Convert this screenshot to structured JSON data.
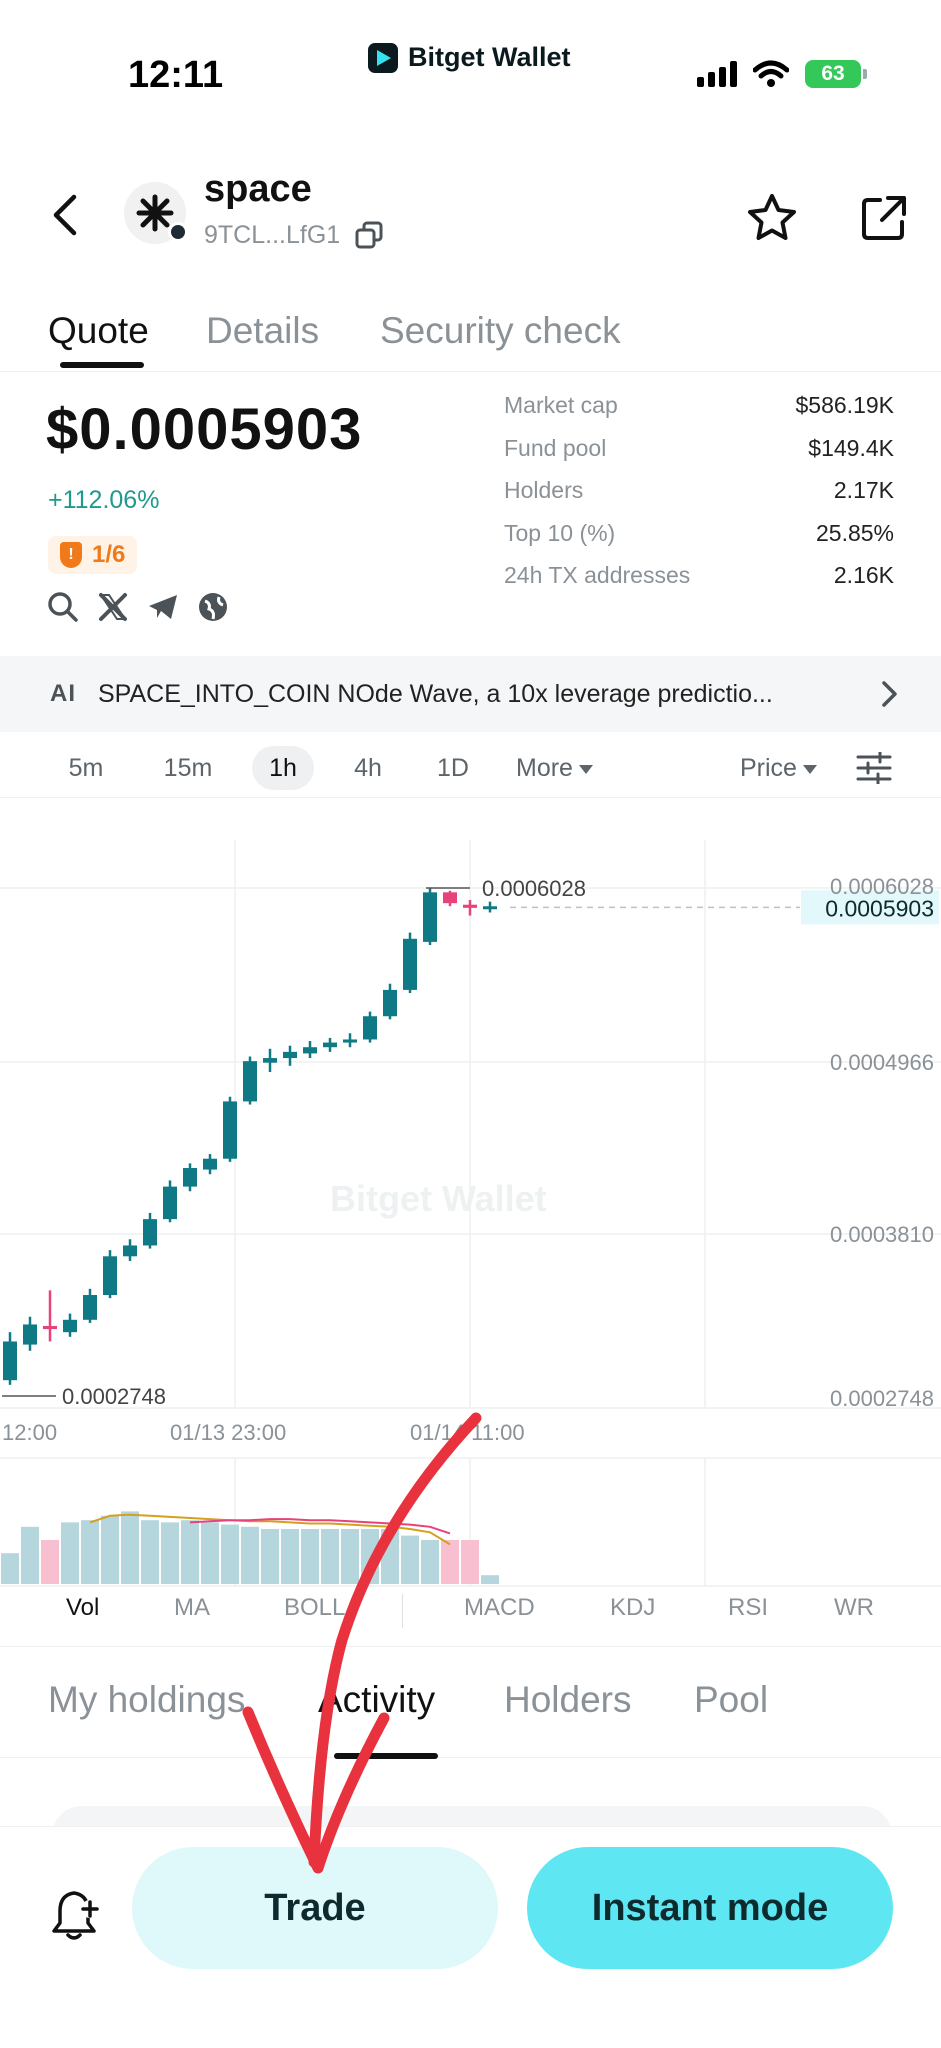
{
  "status_bar": {
    "time": "12:11",
    "app_name": "Bitget Wallet",
    "battery": "63"
  },
  "header": {
    "token_name": "space",
    "token_address": "9TCL...LfG1"
  },
  "tabs": [
    {
      "label": "Quote",
      "active": true
    },
    {
      "label": "Details",
      "active": false
    },
    {
      "label": "Security check",
      "active": false
    }
  ],
  "quote": {
    "price": "$0.0005903",
    "change": "+112.06%",
    "risk_score": "1/6"
  },
  "stats": [
    {
      "label": "Market cap",
      "value": "$586.19K"
    },
    {
      "label": "Fund pool",
      "value": "$149.4K"
    },
    {
      "label": "Holders",
      "value": "2.17K"
    },
    {
      "label": "Top 10 (%)",
      "value": "25.85%"
    },
    {
      "label": "24h TX addresses",
      "value": "2.16K"
    }
  ],
  "ai_banner": {
    "icon_label": "AI",
    "text": "SPACE_INTO_COIN NOde Wave, a 10x leverage predictio..."
  },
  "intervals": [
    {
      "label": "5m",
      "active": false
    },
    {
      "label": "15m",
      "active": false
    },
    {
      "label": "1h",
      "active": true
    },
    {
      "label": "4h",
      "active": false
    },
    {
      "label": "1D",
      "active": false
    },
    {
      "label": "More",
      "active": false
    }
  ],
  "price_mode": "Price",
  "chart_data": {
    "type": "candlestick",
    "watermark": "Bitget Wallet",
    "y_ticks": [
      "0.0006028",
      "0.0004966",
      "0.0003810",
      "0.0002748"
    ],
    "current_price": "0.0005903",
    "high_label": "0.0006028",
    "low_label": "0.0002748",
    "x_ticks": [
      "12:00",
      "01/13 23:00",
      "01/14 11:00"
    ],
    "ylim": [
      0.0002748,
      0.0006028
    ],
    "candles": [
      {
        "o": 0.000285,
        "c": 0.00031,
        "h": 0.000316,
        "l": 0.000282
      },
      {
        "o": 0.000308,
        "c": 0.000321,
        "h": 0.000326,
        "l": 0.000304
      },
      {
        "o": 0.00032,
        "c": 0.000318,
        "h": 0.000343,
        "l": 0.00031
      },
      {
        "o": 0.000316,
        "c": 0.000324,
        "h": 0.000328,
        "l": 0.000313
      },
      {
        "o": 0.000324,
        "c": 0.00034,
        "h": 0.000344,
        "l": 0.000322
      },
      {
        "o": 0.00034,
        "c": 0.000365,
        "h": 0.000369,
        "l": 0.000338
      },
      {
        "o": 0.000365,
        "c": 0.000372,
        "h": 0.000376,
        "l": 0.000362
      },
      {
        "o": 0.000372,
        "c": 0.000389,
        "h": 0.000393,
        "l": 0.00037
      },
      {
        "o": 0.000389,
        "c": 0.00041,
        "h": 0.000414,
        "l": 0.000387
      },
      {
        "o": 0.00041,
        "c": 0.000422,
        "h": 0.000425,
        "l": 0.000407
      },
      {
        "o": 0.000421,
        "c": 0.000428,
        "h": 0.000431,
        "l": 0.000418
      },
      {
        "o": 0.000428,
        "c": 0.000465,
        "h": 0.000468,
        "l": 0.000426
      },
      {
        "o": 0.000465,
        "c": 0.000491,
        "h": 0.000494,
        "l": 0.000463
      },
      {
        "o": 0.00049,
        "c": 0.000493,
        "h": 0.000499,
        "l": 0.000484
      },
      {
        "o": 0.000493,
        "c": 0.000497,
        "h": 0.000501,
        "l": 0.000488
      },
      {
        "o": 0.000496,
        "c": 0.0005,
        "h": 0.000504,
        "l": 0.000493
      },
      {
        "o": 0.0005,
        "c": 0.000503,
        "h": 0.000506,
        "l": 0.000497
      },
      {
        "o": 0.000503,
        "c": 0.000505,
        "h": 0.000509,
        "l": 0.0005
      },
      {
        "o": 0.000505,
        "c": 0.00052,
        "h": 0.000523,
        "l": 0.000503
      },
      {
        "o": 0.00052,
        "c": 0.000537,
        "h": 0.000541,
        "l": 0.000518
      },
      {
        "o": 0.000537,
        "c": 0.00057,
        "h": 0.000574,
        "l": 0.000535
      },
      {
        "o": 0.000568,
        "c": 0.0006,
        "h": 0.000603,
        "l": 0.000566
      },
      {
        "o": 0.0006,
        "c": 0.000593,
        "h": 0.000601,
        "l": 0.000591
      },
      {
        "o": 0.000592,
        "c": 0.00059,
        "h": 0.000595,
        "l": 0.000585
      },
      {
        "o": 0.00059,
        "c": 0.000591,
        "h": 0.000594,
        "l": 0.000587
      }
    ],
    "volume": [
      0.28,
      0.52,
      0.4,
      0.56,
      0.58,
      0.62,
      0.66,
      0.58,
      0.56,
      0.58,
      0.56,
      0.54,
      0.52,
      0.5,
      0.5,
      0.5,
      0.5,
      0.5,
      0.5,
      0.5,
      0.44,
      0.4,
      0.4,
      0.4,
      0.08
    ]
  },
  "indicators": [
    {
      "label": "Vol",
      "active": true
    },
    {
      "label": "MA",
      "active": false
    },
    {
      "label": "BOLL",
      "active": false
    },
    {
      "label": "MACD",
      "active": false
    },
    {
      "label": "KDJ",
      "active": false
    },
    {
      "label": "RSI",
      "active": false
    },
    {
      "label": "WR",
      "active": false
    }
  ],
  "section_tabs": [
    {
      "label": "My holdings",
      "active": false
    },
    {
      "label": "Activity",
      "active": true
    },
    {
      "label": "Holders",
      "active": false
    },
    {
      "label": "Pool",
      "active": false
    }
  ],
  "bottom_bar": {
    "trade_label": "Trade",
    "instant_label": "Instant mode"
  },
  "colors": {
    "up": "#0f7a86",
    "down": "#e8427c",
    "accent": "#5ee7f2",
    "annotation": "#e8333f"
  }
}
